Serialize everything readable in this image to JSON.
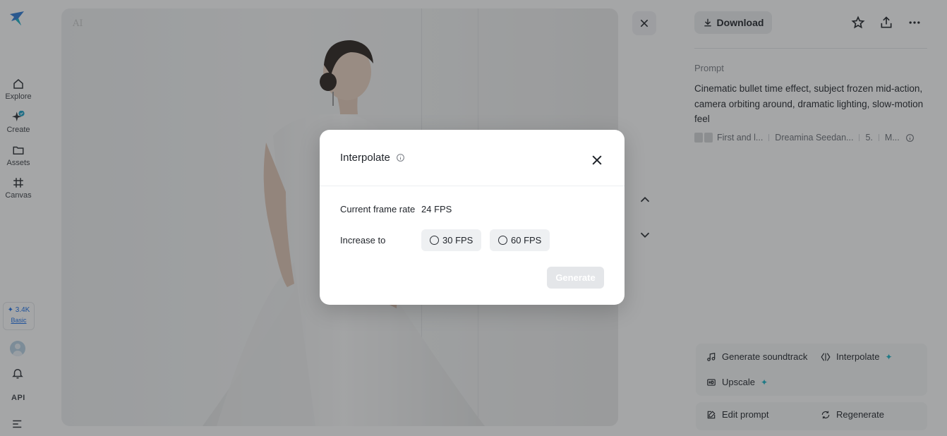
{
  "sidebar": {
    "items": [
      {
        "label": "Explore",
        "icon": "home-icon"
      },
      {
        "label": "Create",
        "icon": "sparkle-create-icon"
      },
      {
        "label": "Assets",
        "icon": "folder-icon"
      },
      {
        "label": "Canvas",
        "icon": "crop-grid-icon"
      }
    ],
    "credits": {
      "amount": "✦ 3.4K",
      "plan": "Basic"
    },
    "api_label": "API"
  },
  "image": {
    "watermark": "AI"
  },
  "panel": {
    "download_label": "Download",
    "prompt_heading": "Prompt",
    "prompt_text": "Cinematic bullet time effect, subject frozen mid-action, camera orbiting around, dramatic lighting, slow-motion feel",
    "meta": {
      "mode": "First and l...",
      "model": "Dreamina Seedan...",
      "duration": "5.",
      "extra": "M..."
    },
    "actions": {
      "soundtrack": "Generate soundtrack",
      "interpolate": "Interpolate",
      "upscale": "Upscale",
      "edit_prompt": "Edit prompt",
      "regenerate": "Regenerate"
    }
  },
  "modal": {
    "title": "Interpolate",
    "current_label": "Current frame rate",
    "current_value": "24 FPS",
    "increase_label": "Increase to",
    "options": [
      "30 FPS",
      "60 FPS"
    ],
    "generate_label": "Generate"
  },
  "colors": {
    "accent": "#19b3c6",
    "link": "#1a6fe8",
    "overlay": "#28292e"
  }
}
